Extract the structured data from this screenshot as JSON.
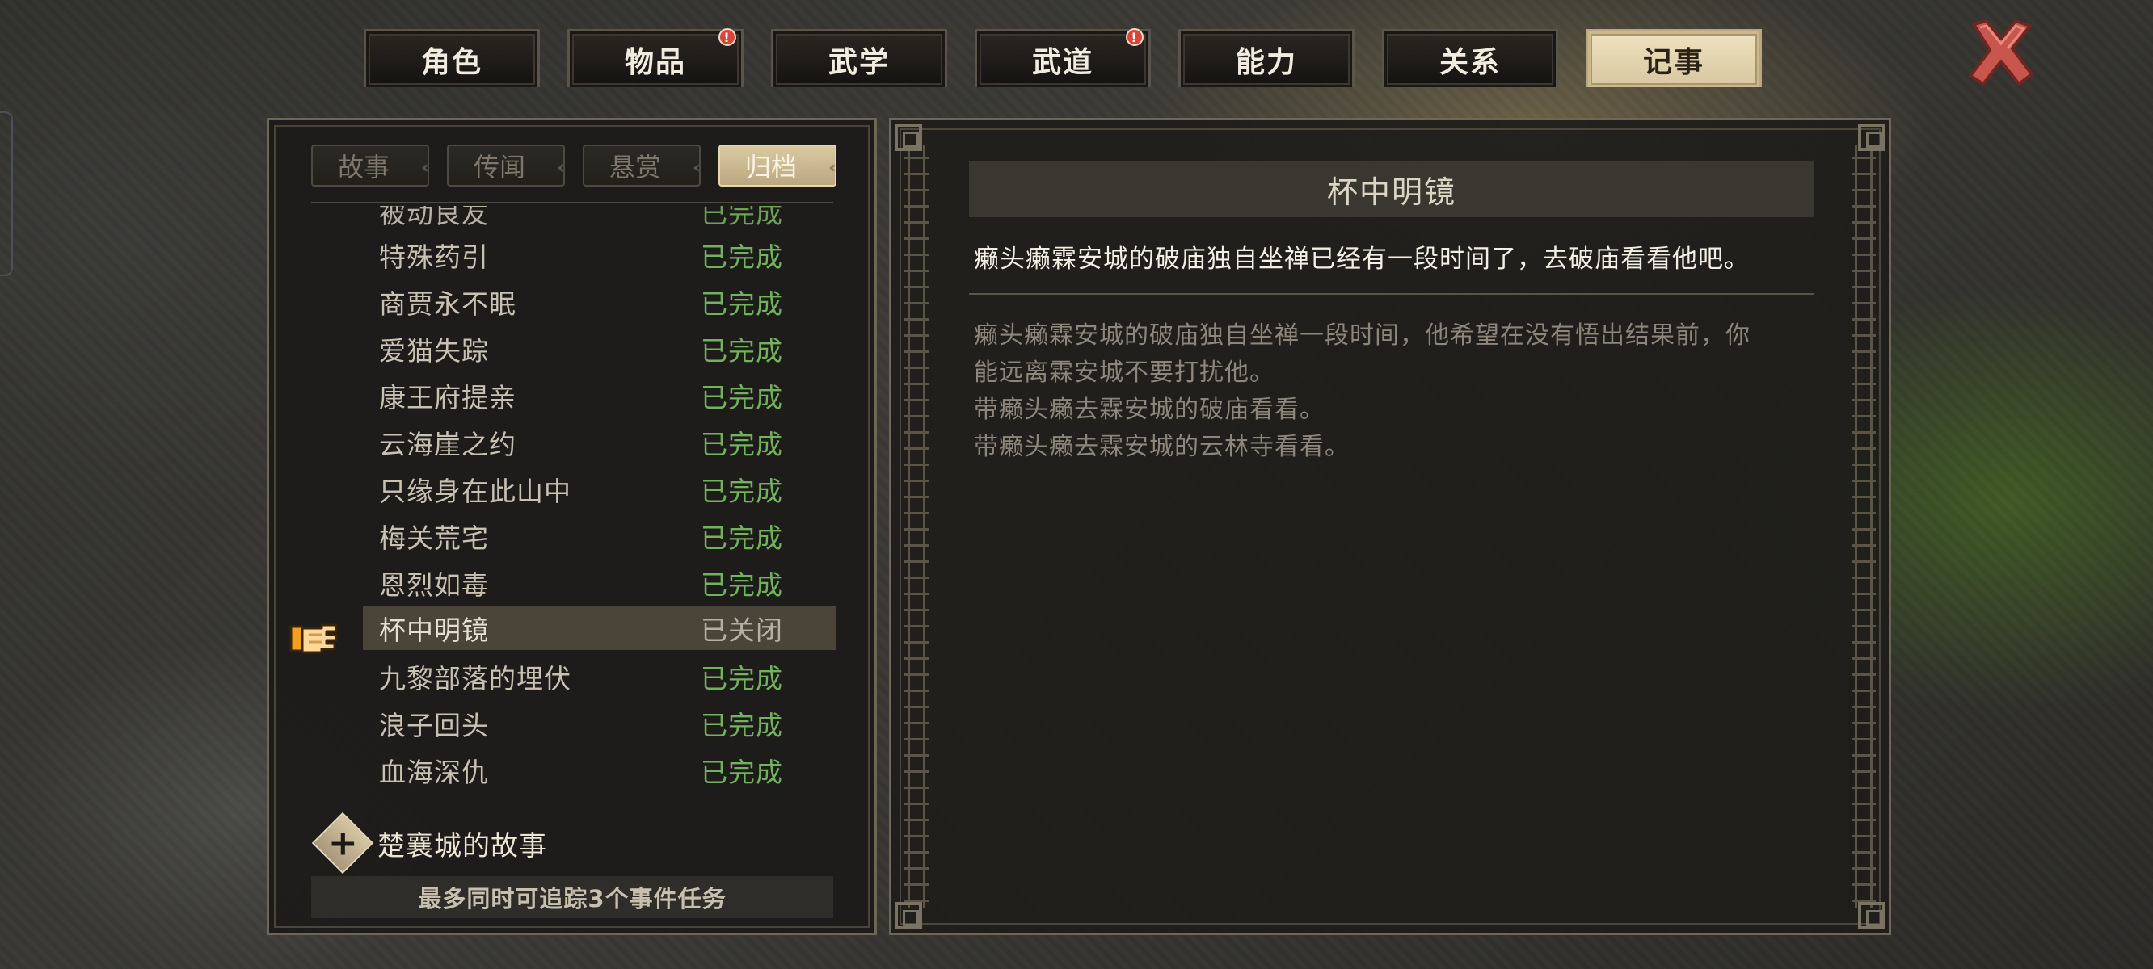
{
  "tabs": [
    {
      "label": "角色",
      "badge": false,
      "active": false
    },
    {
      "label": "物品",
      "badge": true,
      "active": false
    },
    {
      "label": "武学",
      "badge": false,
      "active": false
    },
    {
      "label": "武道",
      "badge": true,
      "active": false
    },
    {
      "label": "能力",
      "badge": false,
      "active": false
    },
    {
      "label": "关系",
      "badge": false,
      "active": false
    },
    {
      "label": "记事",
      "badge": false,
      "active": true
    }
  ],
  "badge_glyph": "!",
  "subtabs": [
    {
      "label": "故事",
      "active": false
    },
    {
      "label": "传闻",
      "active": false
    },
    {
      "label": "悬赏",
      "active": false
    },
    {
      "label": "归档",
      "active": true
    }
  ],
  "quests": [
    {
      "name": "被动良友",
      "status": "已完成",
      "selected": false
    },
    {
      "name": "特殊药引",
      "status": "已完成",
      "selected": false
    },
    {
      "name": "商贾永不眠",
      "status": "已完成",
      "selected": false
    },
    {
      "name": "爱猫失踪",
      "status": "已完成",
      "selected": false
    },
    {
      "name": "康王府提亲",
      "status": "已完成",
      "selected": false
    },
    {
      "name": "云海崖之约",
      "status": "已完成",
      "selected": false
    },
    {
      "name": "只缘身在此山中",
      "status": "已完成",
      "selected": false
    },
    {
      "name": "梅关荒宅",
      "status": "已完成",
      "selected": false
    },
    {
      "name": "恩烈如毒",
      "status": "已完成",
      "selected": false
    },
    {
      "name": "杯中明镜",
      "status": "已关闭",
      "selected": true
    },
    {
      "name": "九黎部落的埋伏",
      "status": "已完成",
      "selected": false
    },
    {
      "name": "浪子回头",
      "status": "已完成",
      "selected": false
    },
    {
      "name": "血海深仇",
      "status": "已完成",
      "selected": false
    }
  ],
  "group": {
    "label": "楚襄城的故事",
    "icon": "plus-icon"
  },
  "footer_note": "最多同时可追踪3个事件任务",
  "detail": {
    "title": "杯中明镜",
    "summary": "癞头癞霖安城的破庙独自坐禅已经有一段时间了，去破庙看看他吧。",
    "body_lines": [
      "癞头癞霖安城的破庙独自坐禅一段时间，他希望在没有悟出结果前，你",
      "能远离霖安城不要打扰他。",
      "带癞头癞去霖安城的破庙看看。",
      "带癞头癞去霖安城的云林寺看看。"
    ]
  },
  "colors": {
    "status_done": "#73b25d",
    "status_closed": "#b7afa0",
    "active_tab": "#e8d9b4",
    "badge": "#d8453a",
    "close_x": "#c9564c"
  }
}
